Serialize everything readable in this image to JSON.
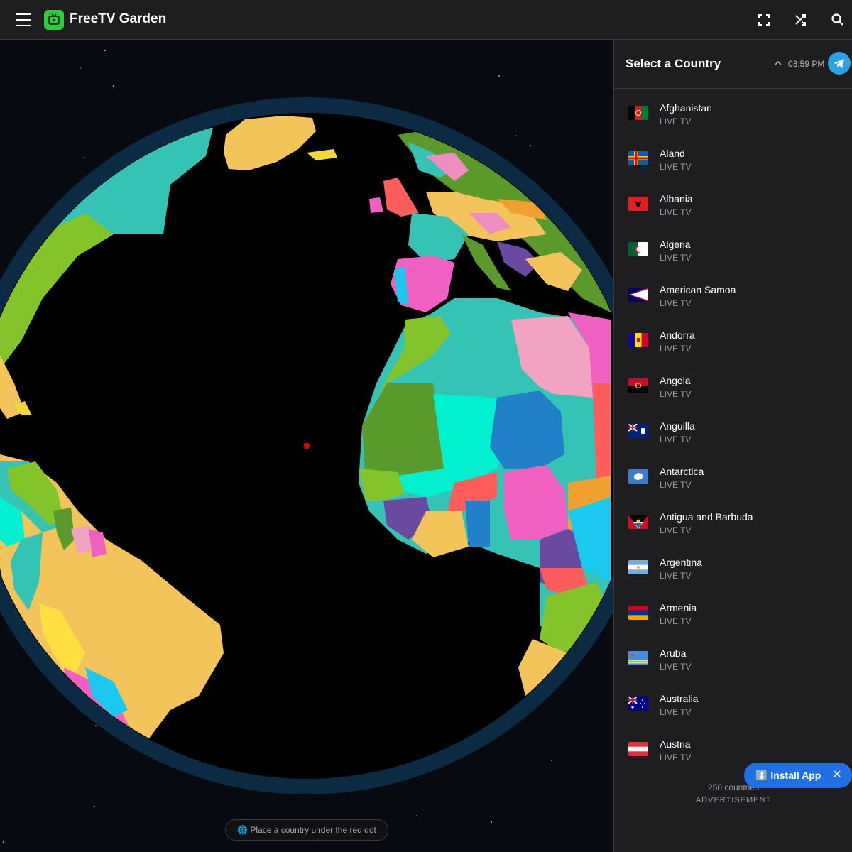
{
  "header": {
    "app_title": "FreeTV Garden",
    "icons": [
      "menu-icon",
      "tv-logo-icon",
      "fullscreen-icon",
      "shuffle-icon",
      "search-icon"
    ]
  },
  "sidebar": {
    "title": "Select a Country",
    "time": "03:59 PM",
    "countries": [
      {
        "name": "Afghanistan",
        "sub": "LIVE TV"
      },
      {
        "name": "Aland",
        "sub": "LIVE TV"
      },
      {
        "name": "Albania",
        "sub": "LIVE TV"
      },
      {
        "name": "Algeria",
        "sub": "LIVE TV"
      },
      {
        "name": "American Samoa",
        "sub": "LIVE TV"
      },
      {
        "name": "Andorra",
        "sub": "LIVE TV"
      },
      {
        "name": "Angola",
        "sub": "LIVE TV"
      },
      {
        "name": "Anguilla",
        "sub": "LIVE TV"
      },
      {
        "name": "Antarctica",
        "sub": "LIVE TV"
      },
      {
        "name": "Antigua and Barbuda",
        "sub": "LIVE TV"
      },
      {
        "name": "Argentina",
        "sub": "LIVE TV"
      },
      {
        "name": "Armenia",
        "sub": "LIVE TV"
      },
      {
        "name": "Aruba",
        "sub": "LIVE TV"
      },
      {
        "name": "Australia",
        "sub": "LIVE TV"
      },
      {
        "name": "Austria",
        "sub": "LIVE TV"
      }
    ],
    "count_text": "250 countries",
    "ad_label": "ADVERTISEMENT"
  },
  "install": {
    "label": "⬇️ Install App",
    "close": "✕"
  },
  "globe": {
    "hint": "🌐 Place a country under the red dot"
  },
  "colors": {
    "accent": "#2ecc40",
    "install_bg": "#1f6fe5",
    "telegram": "#2aa3e3",
    "red_dot": "#e00000"
  }
}
